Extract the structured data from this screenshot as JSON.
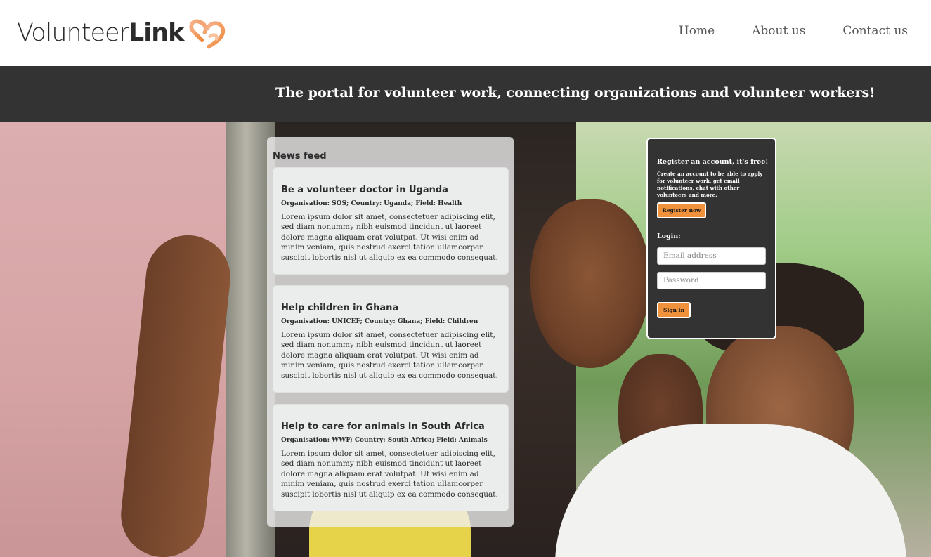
{
  "header": {
    "logo": {
      "light": "Volunteer",
      "bold": "Link"
    },
    "nav": [
      {
        "label": "Home"
      },
      {
        "label": "About us"
      },
      {
        "label": "Contact us"
      }
    ]
  },
  "banner": {
    "text": "The portal for volunteer work, connecting organizations and volunteer workers!"
  },
  "news": {
    "title": "News feed",
    "items": [
      {
        "title": "Be a volunteer doctor in Uganda",
        "meta": "Organisation: SOS; Country: Uganda; Field: Health",
        "body": "Lorem ipsum dolor sit amet, consectetuer adipiscing elit, sed diam nonummy nibh euismod tincidunt ut laoreet dolore magna aliquam erat volutpat. Ut wisi enim ad minim veniam, quis nostrud exerci tation ullamcorper suscipit lobortis nisl ut aliquip ex ea commodo consequat."
      },
      {
        "title": "Help children in Ghana",
        "meta": "Organisation: UNICEF; Country: Ghana; Field: Children",
        "body": "Lorem ipsum dolor sit amet, consectetuer adipiscing elit, sed diam nonummy nibh euismod tincidunt ut laoreet dolore magna aliquam erat volutpat. Ut wisi enim ad minim veniam, quis nostrud exerci tation ullamcorper suscipit lobortis nisl ut aliquip ex ea commodo consequat."
      },
      {
        "title": "Help to care for animals in South Africa",
        "meta": "Organisation: WWF; Country: South Africa; Field: Animals",
        "body": "Lorem ipsum dolor sit amet, consectetuer adipiscing elit, sed diam nonummy nibh euismod tincidunt ut laoreet dolore magna aliquam erat volutpat. Ut wisi enim ad minim veniam, quis nostrud exerci tation ullamcorper suscipit lobortis nisl ut aliquip ex ea commodo consequat."
      }
    ]
  },
  "register": {
    "title": "Register an account, it's free!",
    "description": "Create an account to be able to apply for volunteer work, get email notifications, chat with other volunteers and more.",
    "button": "Register now",
    "login_label": "Login:",
    "email_placeholder": "Email address",
    "password_placeholder": "Password",
    "signin_button": "Sign in"
  },
  "colors": {
    "accent": "#f0913c",
    "dark": "#333333"
  }
}
